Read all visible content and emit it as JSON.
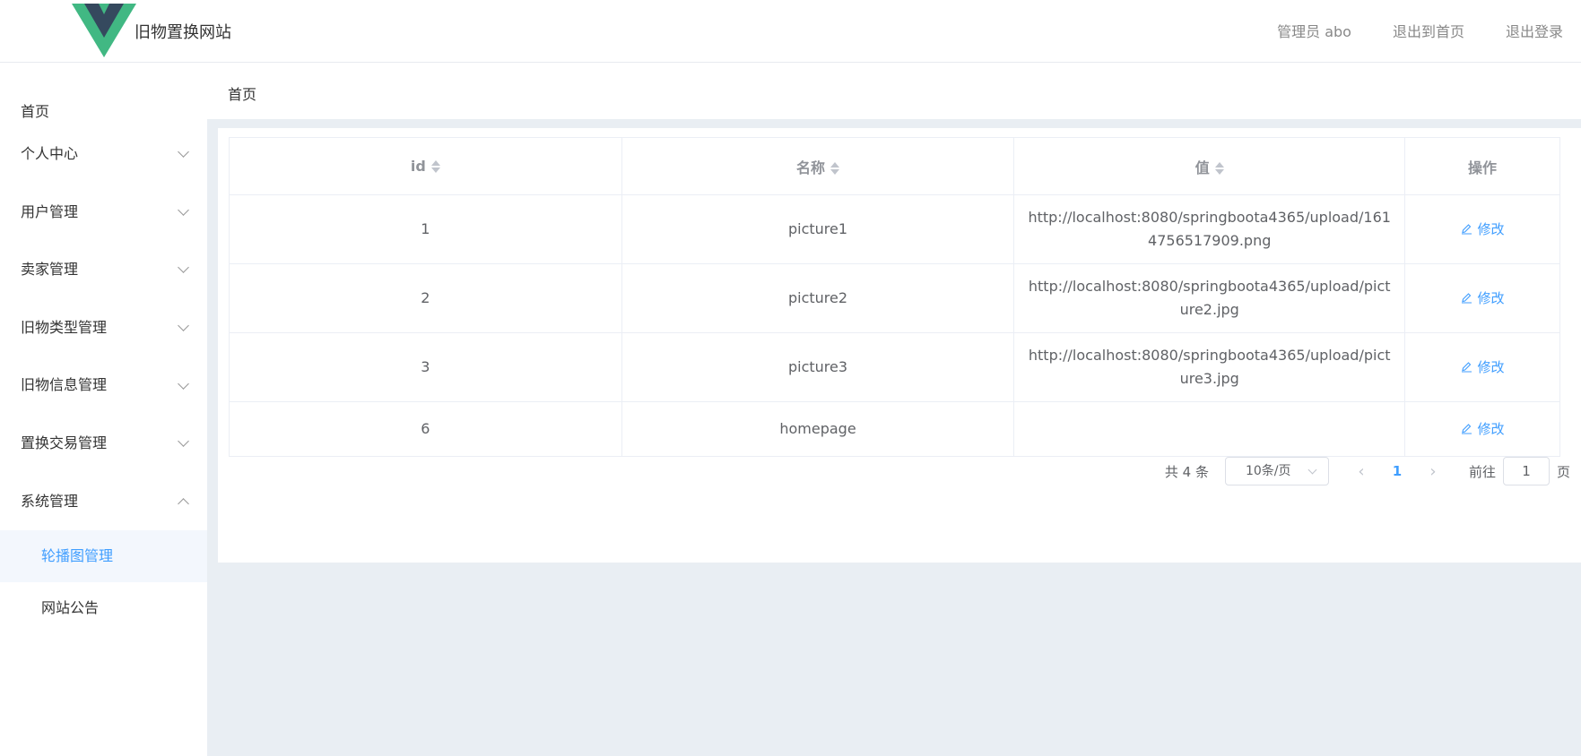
{
  "header": {
    "site_title": "旧物置换网站",
    "user_label": "管理员 abo",
    "back_home": "退出到首页",
    "logout": "退出登录"
  },
  "sidebar": {
    "items": [
      {
        "label": "首页"
      },
      {
        "label": "个人中心"
      },
      {
        "label": "用户管理"
      },
      {
        "label": "卖家管理"
      },
      {
        "label": "旧物类型管理"
      },
      {
        "label": "旧物信息管理"
      },
      {
        "label": "置换交易管理"
      },
      {
        "label": "系统管理"
      }
    ],
    "sub_items": [
      {
        "label": "轮播图管理",
        "active": true
      },
      {
        "label": "网站公告",
        "active": false
      }
    ]
  },
  "breadcrumb": "首页",
  "table": {
    "headers": {
      "id": "id",
      "name": "名称",
      "value": "值",
      "op": "操作"
    },
    "rows": [
      {
        "id": "1",
        "name": "picture1",
        "value": "http://localhost:8080/springboota4365/upload/1614756517909.png",
        "op": "修改"
      },
      {
        "id": "2",
        "name": "picture2",
        "value": "http://localhost:8080/springboota4365/upload/picture2.jpg",
        "op": "修改"
      },
      {
        "id": "3",
        "name": "picture3",
        "value": "http://localhost:8080/springboota4365/upload/picture3.jpg",
        "op": "修改"
      },
      {
        "id": "6",
        "name": "homepage",
        "value": "",
        "op": "修改"
      }
    ]
  },
  "pagination": {
    "total": "共 4 条",
    "page_size": "10条/页",
    "current_page": "1",
    "goto_label": "前往",
    "goto_value": "1",
    "goto_unit": "页",
    "prev_icon": "‹",
    "next_icon": "›"
  },
  "colors": {
    "accent": "#409eff",
    "logo_green": "#41b883",
    "logo_dark": "#35495e",
    "main_bg": "#e9eef3"
  }
}
